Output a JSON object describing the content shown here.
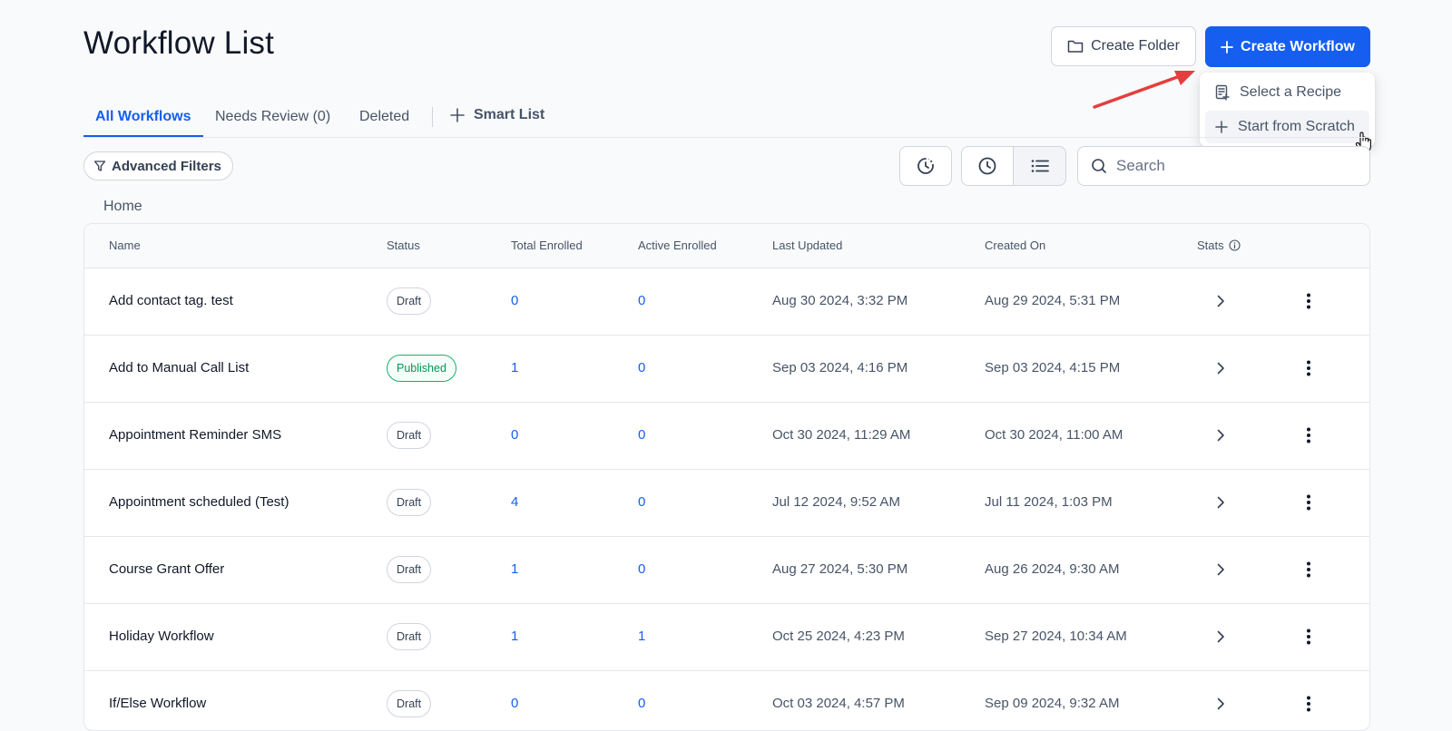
{
  "page": {
    "title": "Workflow List"
  },
  "header": {
    "create_folder_label": "Create Folder",
    "create_workflow_label": "Create Workflow"
  },
  "dropdown": {
    "items": [
      {
        "label": "Select a Recipe",
        "icon": "recipe-icon"
      },
      {
        "label": "Start from Scratch",
        "icon": "plus-icon"
      }
    ]
  },
  "tabs": [
    {
      "label": "All Workflows",
      "active": true
    },
    {
      "label": "Needs Review (0)"
    },
    {
      "label": "Deleted"
    }
  ],
  "smart_list_label": "Smart List",
  "toolbar": {
    "advanced_filters_label": "Advanced Filters",
    "search_placeholder": "Search"
  },
  "breadcrumb": "Home",
  "table": {
    "headers": {
      "name": "Name",
      "status": "Status",
      "total": "Total Enrolled",
      "active": "Active Enrolled",
      "updated": "Last Updated",
      "created": "Created On",
      "stats": "Stats"
    },
    "rows": [
      {
        "name": "Add contact tag. test",
        "status": "Draft",
        "total": "0",
        "active": "0",
        "updated": "Aug 30 2024, 3:32 PM",
        "created": "Aug 29 2024, 5:31 PM"
      },
      {
        "name": "Add to Manual Call List",
        "status": "Published",
        "total": "1",
        "active": "0",
        "updated": "Sep 03 2024, 4:16 PM",
        "created": "Sep 03 2024, 4:15 PM"
      },
      {
        "name": "Appointment Reminder SMS",
        "status": "Draft",
        "total": "0",
        "active": "0",
        "updated": "Oct 30 2024, 11:29 AM",
        "created": "Oct 30 2024, 11:00 AM"
      },
      {
        "name": "Appointment scheduled (Test)",
        "status": "Draft",
        "total": "4",
        "active": "0",
        "updated": "Jul 12 2024, 9:52 AM",
        "created": "Jul 11 2024, 1:03 PM"
      },
      {
        "name": "Course Grant Offer",
        "status": "Draft",
        "total": "1",
        "active": "0",
        "updated": "Aug 27 2024, 5:30 PM",
        "created": "Aug 26 2024, 9:30 AM"
      },
      {
        "name": "Holiday Workflow",
        "status": "Draft",
        "total": "1",
        "active": "1",
        "updated": "Oct 25 2024, 4:23 PM",
        "created": "Sep 27 2024, 10:34 AM"
      },
      {
        "name": "If/Else Workflow",
        "status": "Draft",
        "total": "0",
        "active": "0",
        "updated": "Oct 03 2024, 4:57 PM",
        "created": "Sep 09 2024, 9:32 AM"
      }
    ]
  },
  "colors": {
    "accent": "#155eef",
    "published": "#17b26a",
    "annotation_arrow": "#e53e3e"
  }
}
